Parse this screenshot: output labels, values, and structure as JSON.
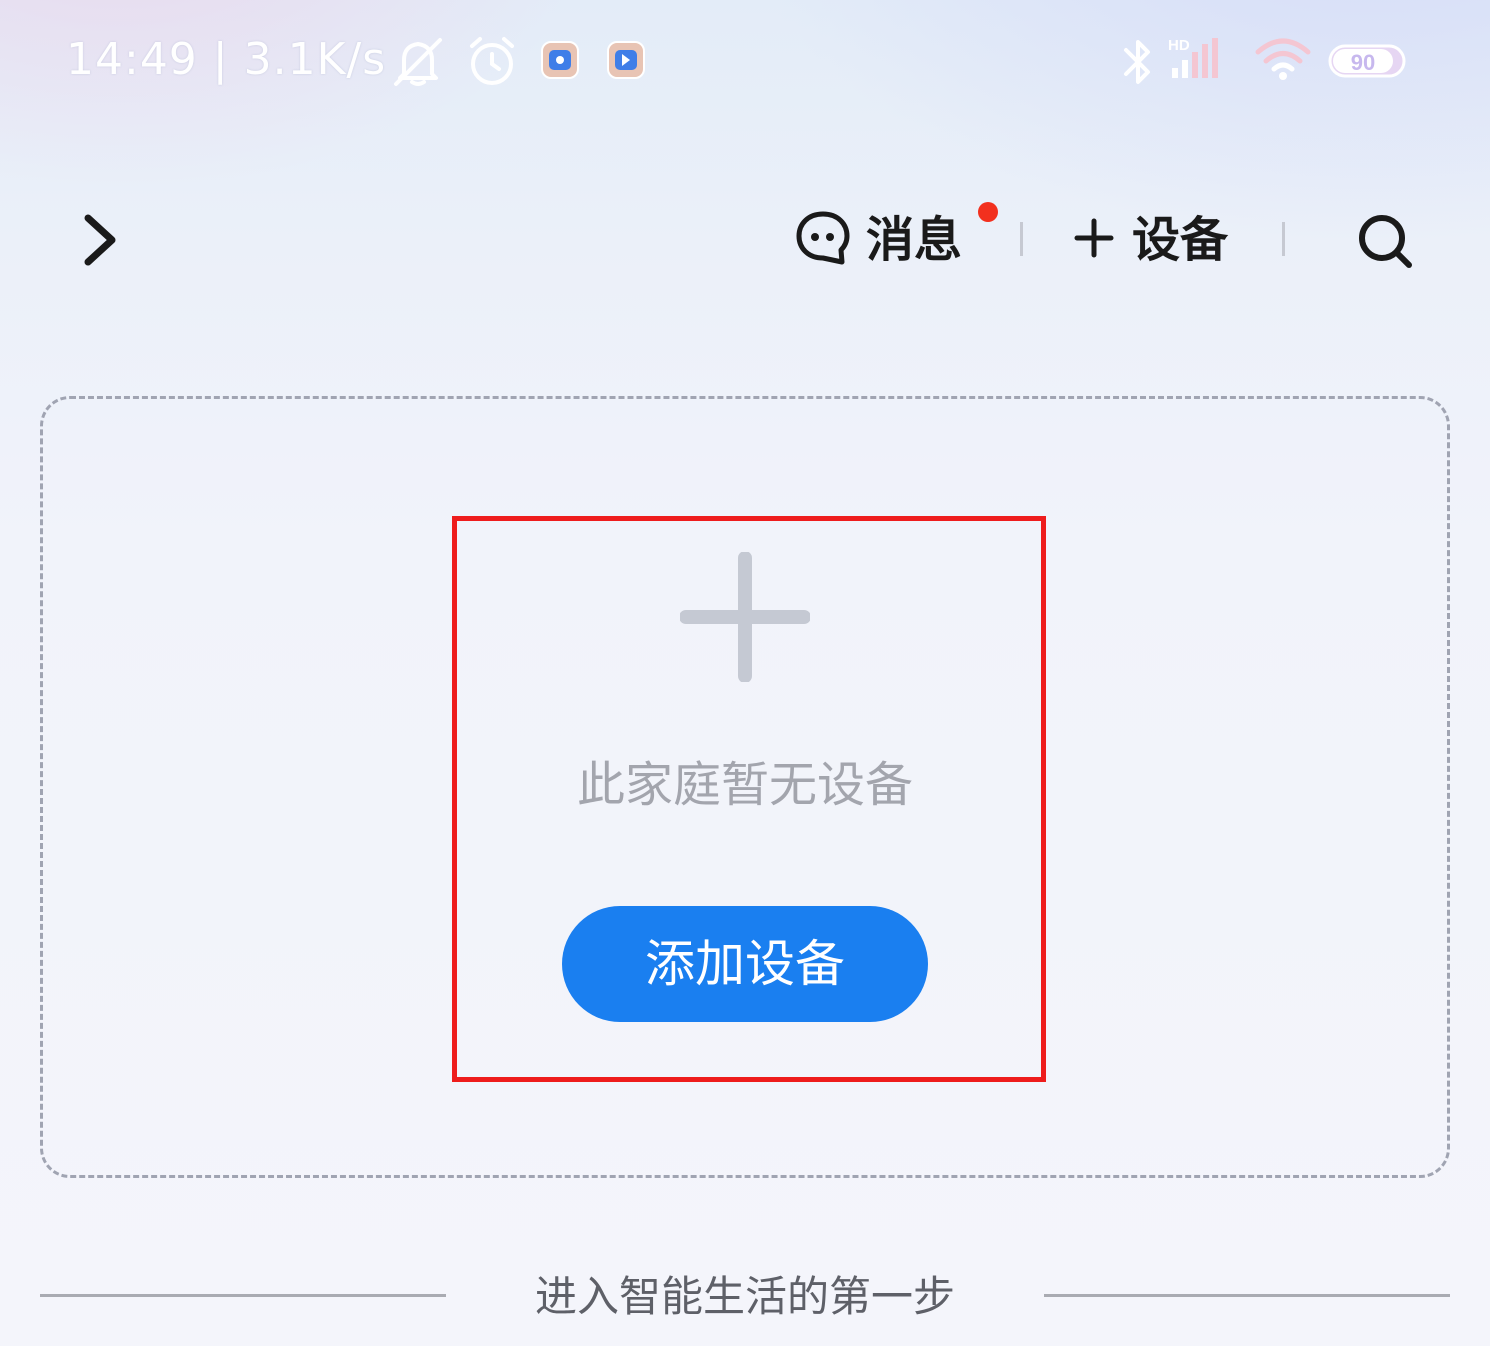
{
  "status_bar": {
    "time_and_speed": "14:49 | 3.1K/s",
    "network_badge": "HD",
    "battery_level": "90",
    "icons": [
      "mute-icon",
      "alarm-icon",
      "notification-app-icon",
      "notification-app-icon",
      "bluetooth-icon",
      "cellular-signal-icon",
      "wifi-icon",
      "battery-icon"
    ]
  },
  "top_bar": {
    "expand_icon": "chevron-right-icon",
    "messages_label": "消息",
    "messages_icon": "chat-bubble-icon",
    "messages_has_unread": true,
    "add_device_label": "设备",
    "add_device_icon": "plus-icon",
    "search_icon": "search-icon"
  },
  "empty_state": {
    "icon": "plus-icon",
    "message": "此家庭暂无设备",
    "button_label": "添加设备"
  },
  "section": {
    "title": "进入智能生活的第一步"
  },
  "colors": {
    "accent": "#1a7ff0",
    "highlight_border": "#ee1c1c",
    "unread_dot": "#f2301e"
  }
}
